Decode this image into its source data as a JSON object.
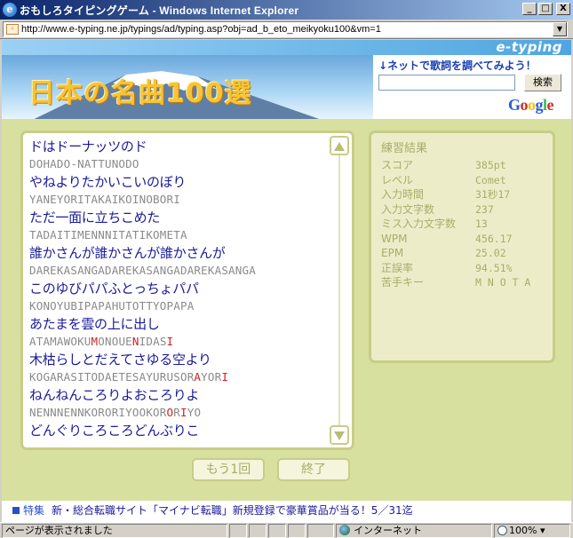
{
  "window": {
    "title": "おもしろタイピングゲーム - Windows Internet Explorer",
    "btn_min": "_",
    "btn_max": "□",
    "btn_close": "X"
  },
  "address": {
    "url": "http://www.e-typing.ne.jp/typings/ad/typing.asp?obj=ad_b_eto_meikyoku100&vm=1"
  },
  "header": {
    "logo": "e-typing",
    "banner_title": "日本の名曲100選",
    "search_hint": "↓ネットで歌詞を調べてみよう！",
    "search_button": "検索",
    "google": "Google"
  },
  "songs": [
    {
      "jp": "ドはドーナッツのド",
      "romaji": [
        {
          "t": "DOHADO-NATTUNODO",
          "err": false
        }
      ]
    },
    {
      "jp": "やねよりたかいこいのぼり",
      "romaji": [
        {
          "t": "YANEYORITAKAIKOINOBORI",
          "err": false
        }
      ]
    },
    {
      "jp": "ただ一面に立ちこめた",
      "romaji": [
        {
          "t": "TADAITIMENNNITATIKOMETA",
          "err": false
        }
      ]
    },
    {
      "jp": "誰かさんが誰かさんが誰かさんが",
      "romaji": [
        {
          "t": "DAREKASANGADAREKASANGADAREKASANGA",
          "err": false
        }
      ]
    },
    {
      "jp": "このゆびパパふとっちょパパ",
      "romaji": [
        {
          "t": "KONOYUBIPAPAHUTOTTYOPAPA",
          "err": false
        }
      ]
    },
    {
      "jp": "あたまを雲の上に出し",
      "romaji": [
        {
          "t": "ATAMAWOKU",
          "err": false
        },
        {
          "t": "M",
          "err": true
        },
        {
          "t": "ONOUE",
          "err": false
        },
        {
          "t": "N",
          "err": true
        },
        {
          "t": "IDAS",
          "err": false
        },
        {
          "t": "I",
          "err": true
        }
      ]
    },
    {
      "jp": "木枯らしとだえてさゆる空より",
      "romaji": [
        {
          "t": "KOGARASITODAETESAYURUSOR",
          "err": false
        },
        {
          "t": "A",
          "err": true
        },
        {
          "t": "YOR",
          "err": false
        },
        {
          "t": "I",
          "err": true
        }
      ]
    },
    {
      "jp": "ねんねんころりよおころりよ",
      "romaji": [
        {
          "t": "NENNNENNKORORIYOOKOR",
          "err": false
        },
        {
          "t": "O",
          "err": true
        },
        {
          "t": "R",
          "err": false
        },
        {
          "t": "I",
          "err": true
        },
        {
          "t": "YO",
          "err": false
        }
      ]
    },
    {
      "jp": "どんぐりころころどんぶりこ",
      "romaji": []
    }
  ],
  "results": {
    "title": "練習結果",
    "rows": [
      {
        "label": "スコア",
        "value": "385pt"
      },
      {
        "label": "レベル",
        "value": "Comet"
      },
      {
        "label": "入力時間",
        "value": "31秒17"
      },
      {
        "label": "入力文字数",
        "value": "237"
      },
      {
        "label": "ミス入力文字数",
        "value": "13"
      },
      {
        "label": "WPM",
        "value": "456.17"
      },
      {
        "label": "EPM",
        "value": "25.02"
      },
      {
        "label": "正誤率",
        "value": "94.51%"
      },
      {
        "label": "苦手キー",
        "value": "M N O T A"
      }
    ]
  },
  "buttons": {
    "retry": "もう1回",
    "end": "終了"
  },
  "news": {
    "tag": "特集",
    "text": "新・総合転職サイト「マイナビ転職」新規登録で豪華賞品が当る！5／31迄"
  },
  "statusbar": {
    "message": "ページが表示されました",
    "zone": "インターネット",
    "zoom": "100%"
  },
  "colors": {
    "page_bg": "#d8e0a0",
    "song_jp": "#1a1a9a",
    "romaji": "#8a8a8a",
    "romaji_error": "#d02020",
    "result_text": "#a8ad6a"
  }
}
